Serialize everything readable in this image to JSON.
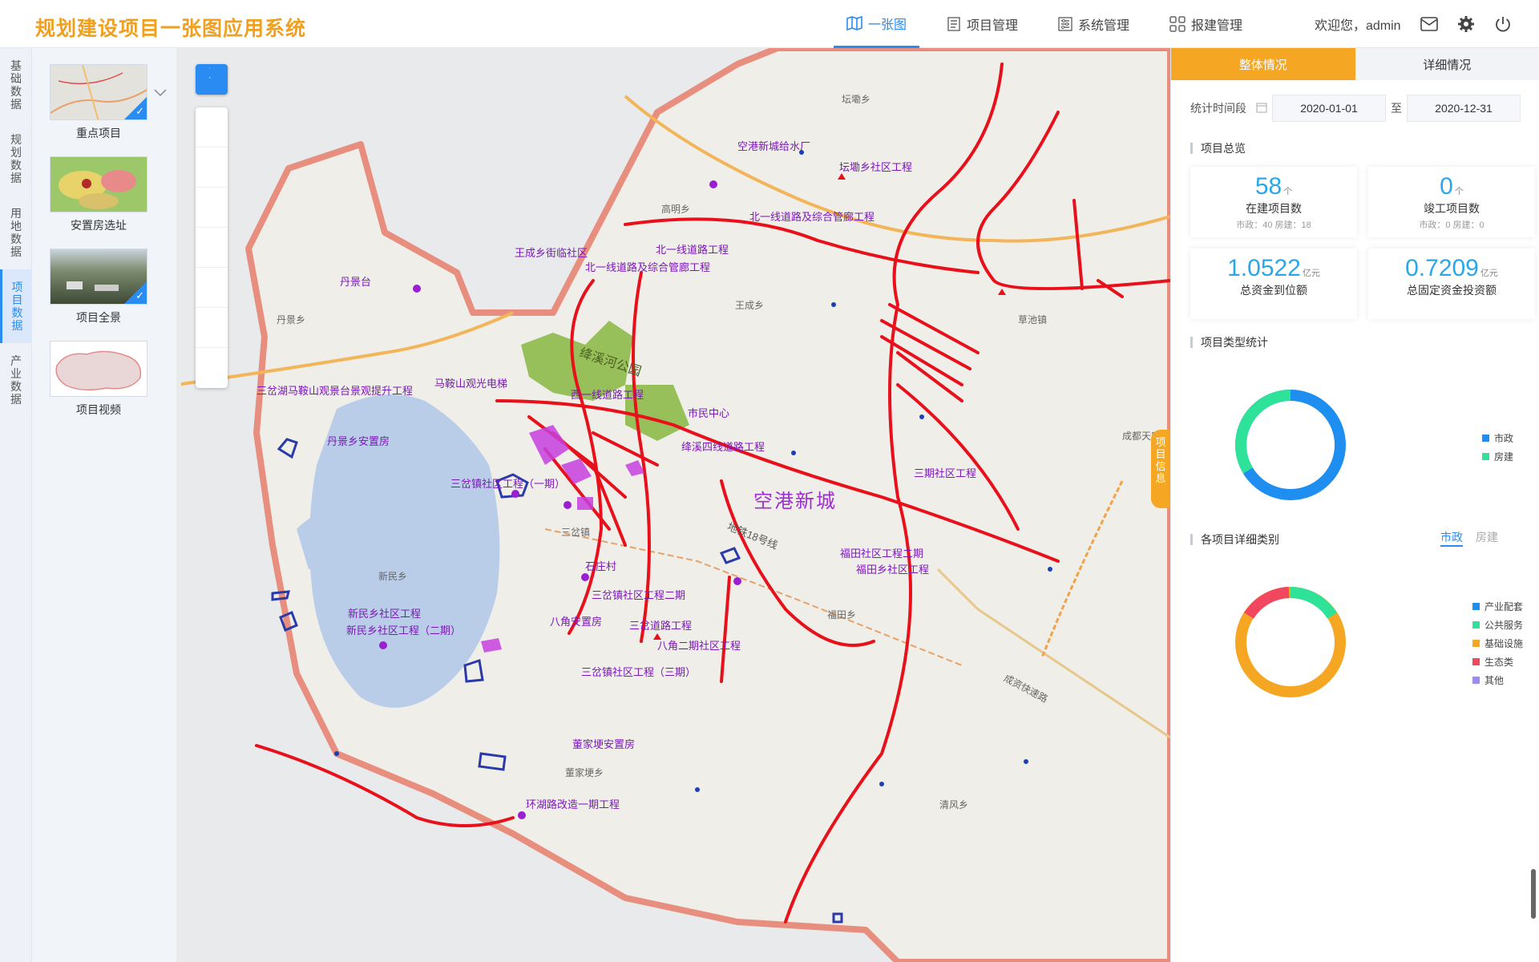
{
  "app": {
    "title": "规划建设项目一张图应用系统"
  },
  "nav": [
    {
      "label": "一张图",
      "icon": "map-icon",
      "active": true
    },
    {
      "label": "项目管理",
      "icon": "document-icon",
      "active": false
    },
    {
      "label": "系统管理",
      "icon": "settings-list-icon",
      "active": false
    },
    {
      "label": "报建管理",
      "icon": "grid-icon",
      "active": false
    }
  ],
  "user": {
    "greeting": "欢迎您，admin"
  },
  "left_tabs": [
    {
      "label": "基础数据",
      "chars": [
        "基",
        "础",
        "数",
        "据"
      ],
      "active": false
    },
    {
      "label": "规划数据",
      "chars": [
        "规",
        "划",
        "数",
        "据"
      ],
      "active": false
    },
    {
      "label": "用地数据",
      "chars": [
        "用",
        "地",
        "数",
        "据"
      ],
      "active": false
    },
    {
      "label": "项目数据",
      "chars": [
        "项",
        "目",
        "数",
        "据"
      ],
      "active": true
    },
    {
      "label": "产业数据",
      "chars": [
        "产",
        "业",
        "数",
        "据"
      ],
      "active": false
    }
  ],
  "thumbs": [
    {
      "label": "重点项目",
      "checked": true
    },
    {
      "label": "安置房选址",
      "checked": false
    },
    {
      "label": "项目全景",
      "checked": true
    },
    {
      "label": "项目视频",
      "checked": false
    }
  ],
  "map": {
    "big_label": "空港新城",
    "side_tab": [
      "项",
      "目",
      "信",
      "息"
    ],
    "project_labels": [
      "空港新城给水厂",
      "坛墈乡社区工程",
      "北一线道路及综合管廊工程",
      "王成乡街临社区",
      "北一线道路工程",
      "北一线道路及综合管廊工程",
      "丹景台",
      "三岔湖马鞍山观景台景观提升工程",
      "马鞍山观光电梯",
      "西一线道路工程",
      "市民中心",
      "丹景乡安置房",
      "三岔镇社区工程（一期）",
      "绛溪四线道路工程",
      "三期社区工程",
      "福田社区工程二期",
      "福田乡社区工程",
      "石庄村",
      "三岔镇社区工程二期",
      "新民乡社区工程",
      "新民乡社区工程（二期）",
      "八角安置房",
      "三岔道路工程",
      "八角二期社区工程",
      "三岔镇社区工程（三期）",
      "董家埂安置房",
      "环湖路改造一期工程"
    ],
    "place_labels": [
      "坛墈乡",
      "高明乡",
      "王成乡",
      "丹景乡",
      "草池镇",
      "三岔镇",
      "新民乡",
      "福田乡",
      "董家埂乡",
      "清风乡",
      "绛溪河公园",
      "地铁18号线",
      "成都天府",
      "成资快速路"
    ]
  },
  "right": {
    "tabs": [
      {
        "label": "整体情况",
        "active": true
      },
      {
        "label": "详细情况",
        "active": false
      }
    ],
    "period_label": "统计时间段",
    "date_from": "2020-01-01",
    "date_sep": "至",
    "date_to": "2020-12-31",
    "overview_title": "项目总览",
    "stats": [
      {
        "value": "58",
        "unit": "个",
        "name": "在建项目数",
        "sub": "市政：40 房建：18"
      },
      {
        "value": "0",
        "unit": "个",
        "name": "竣工项目数",
        "sub": "市政：0 房建：0"
      },
      {
        "value": "1.0522",
        "unit": "亿元",
        "name": "总资金到位额",
        "sub": ""
      },
      {
        "value": "0.7209",
        "unit": "亿元",
        "name": "总固定资金投资额",
        "sub": ""
      }
    ],
    "type_title": "项目类型统计",
    "type_legend": [
      {
        "name": "市政",
        "color": "#1e8ef0"
      },
      {
        "name": "房建",
        "color": "#2ee29a"
      }
    ],
    "detail_title": "各项目详细类别",
    "detail_toggle": [
      {
        "label": "市政",
        "on": true
      },
      {
        "label": "房建",
        "on": false
      }
    ],
    "detail_legend": [
      {
        "name": "产业配套",
        "color": "#1e8ef0"
      },
      {
        "name": "公共服务",
        "color": "#2ee29a"
      },
      {
        "name": "基础设施",
        "color": "#f5a623"
      },
      {
        "name": "生态类",
        "color": "#f2475f"
      },
      {
        "name": "其他",
        "color": "#9b8cf5"
      }
    ]
  }
}
